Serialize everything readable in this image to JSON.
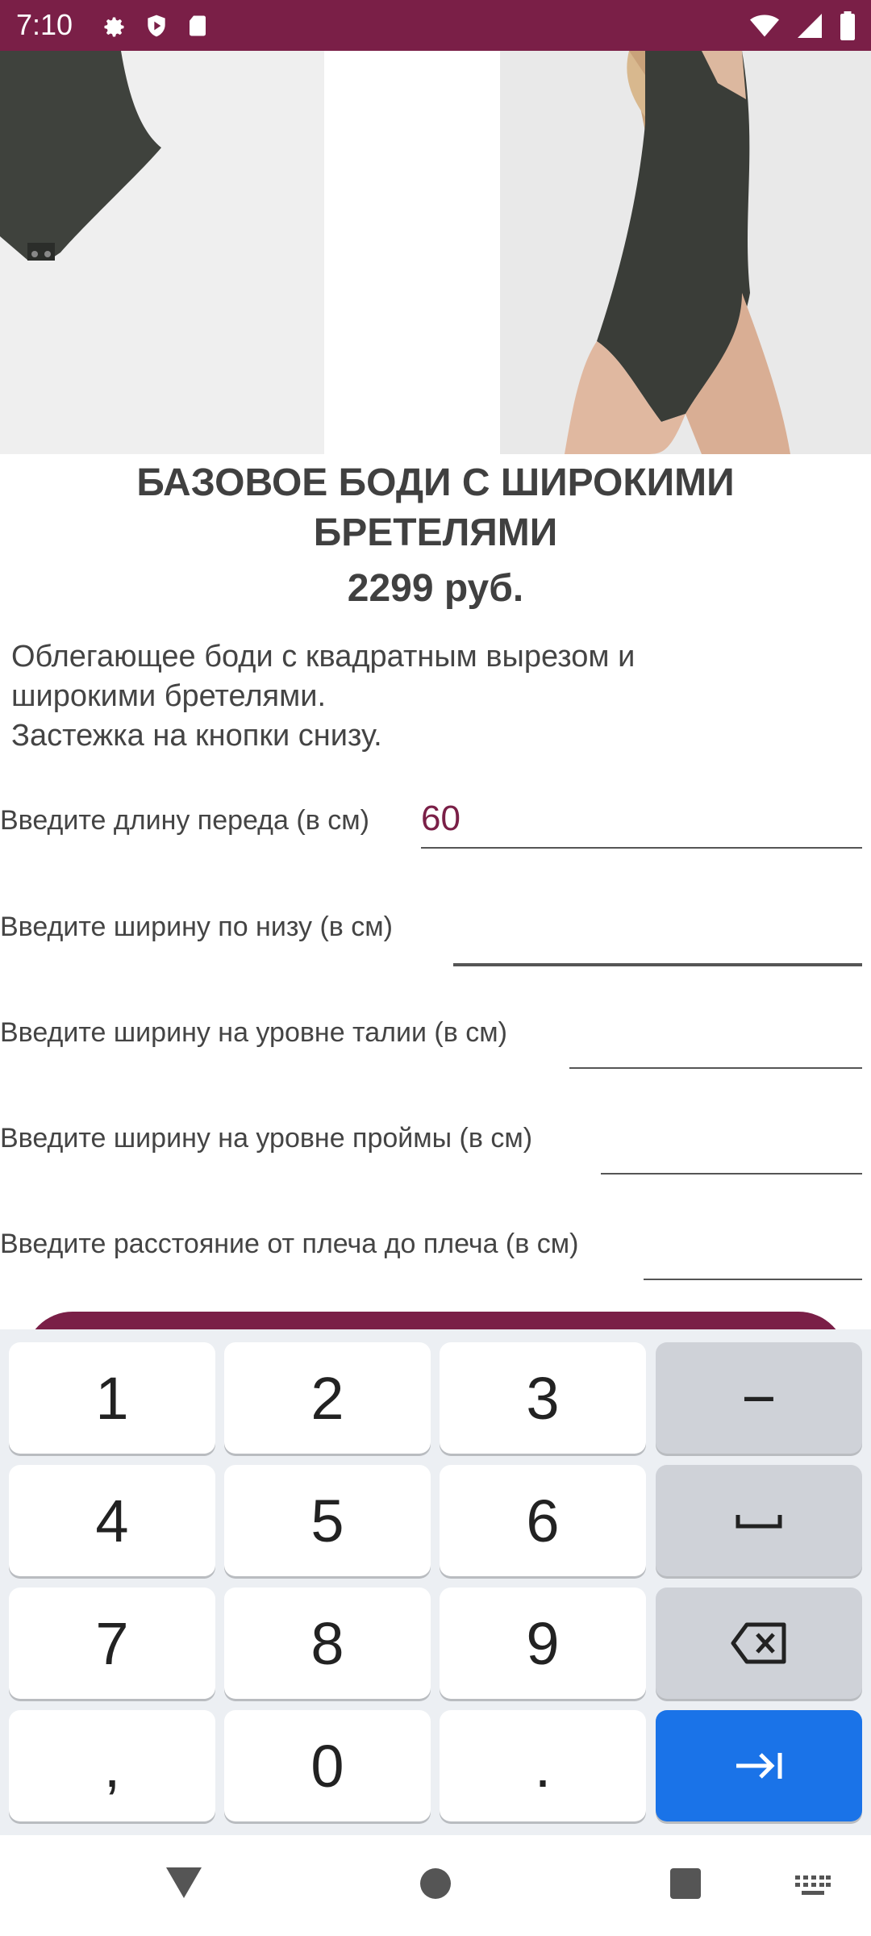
{
  "status_bar": {
    "time": "7:10",
    "icons_left": [
      "gear-icon",
      "shield-icon",
      "sd-card-icon"
    ],
    "icons_right": [
      "wifi-icon",
      "signal-icon",
      "battery-icon"
    ]
  },
  "product": {
    "images": [
      "product-photo-bodysuit",
      "product-photo-model"
    ],
    "title": "БАЗОВОЕ БОДИ С ШИРОКИМИ БРЕТЕЛЯМИ",
    "price": "2299 руб.",
    "description": [
      "Облегающее боди с квадратным вырезом и",
      "широкими бретелями.",
      "Застежка на кнопки снизу."
    ]
  },
  "form": {
    "fields": [
      {
        "label": "Введите длину переда (в см)",
        "value": "60"
      },
      {
        "label": "Введите ширину по низу (в см)",
        "value": ""
      },
      {
        "label": "Введите ширину на уровне талии (в см)",
        "value": ""
      },
      {
        "label": "Введите ширину на уровне проймы (в см)",
        "value": ""
      },
      {
        "label": "Введите расстояние от плеча до плеча (в см)",
        "value": ""
      }
    ]
  },
  "keyboard": {
    "rows": [
      [
        "1",
        "2",
        "3",
        "−"
      ],
      [
        "4",
        "5",
        "6",
        "space-icon"
      ],
      [
        "7",
        "8",
        "9",
        "backspace-icon"
      ],
      [
        ",",
        "0",
        ".",
        "tab-next-icon"
      ]
    ]
  },
  "nav_bar": {
    "icons": [
      "back-icon",
      "home-icon",
      "recents-icon",
      "keyboard-switch-icon"
    ]
  },
  "colors": {
    "accent": "#7a1f47",
    "key_action": "#1a73e8",
    "keyboard_bg": "#eceff3"
  }
}
